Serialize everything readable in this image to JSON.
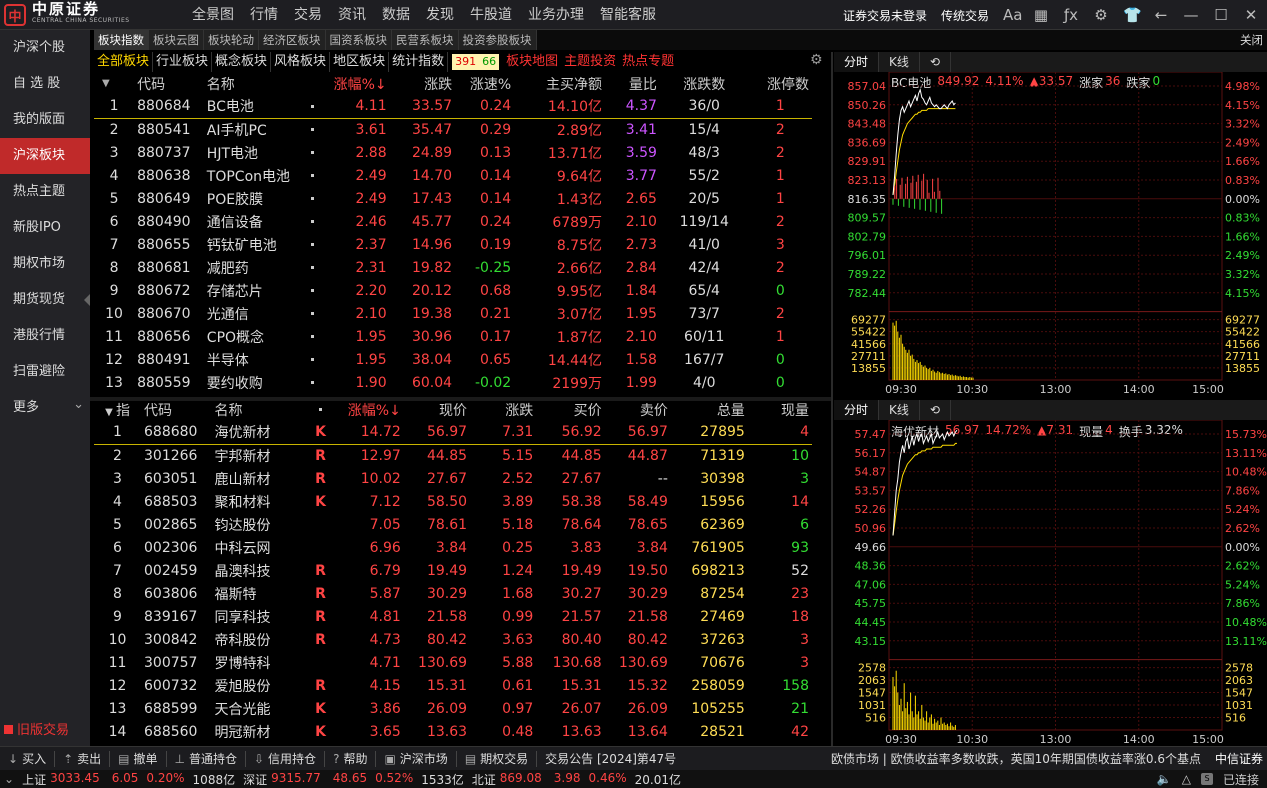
{
  "app": {
    "logo_cn": "中原证券",
    "logo_en": "CENTRAL CHINA SECURITIES"
  },
  "topnav": [
    "全景图",
    "行情",
    "交易",
    "资讯",
    "数据",
    "发现",
    "牛股道",
    "业务办理",
    "智能客服"
  ],
  "topright": {
    "login": "证券交易未登录",
    "mode": "传统交易",
    "font_icon": "font-size-icon",
    "icons": [
      "grid-icon",
      "fx-icon",
      "gear-icon",
      "shirt-icon",
      "back-icon",
      "minimize-icon",
      "maximize-icon",
      "close-icon"
    ]
  },
  "sidebar": {
    "items": [
      "沪深个股",
      "自 选 股",
      "我的版面",
      "沪深板块",
      "热点主题",
      "新股IPO",
      "期权市场",
      "期货现货",
      "港股行情",
      "扫雷避险",
      "更多"
    ],
    "active": 3,
    "old": "旧版交易"
  },
  "tabs": [
    "板块指数",
    "板块云图",
    "板块轮动",
    "经济区板块",
    "国资系板块",
    "民营系板块",
    "投资参股板块"
  ],
  "tabs_close": "关闭",
  "filters": [
    "全部板块",
    "行业板块",
    "概念板块",
    "风格板块",
    "地区板块",
    "统计指数"
  ],
  "filter_counts": [
    "391",
    "66"
  ],
  "filter_links": [
    "板块地图",
    "主题投资",
    "热点专题"
  ],
  "sector_header": [
    "代码",
    "名称",
    "",
    "涨幅%↓",
    "涨跌",
    "涨速%",
    "主买净额",
    "量比",
    "涨跌数",
    "涨停数"
  ],
  "sectors": [
    [
      "1",
      "880684",
      "BC电池",
      "4.11",
      "33.57",
      "0.24",
      "14.10亿",
      "4.37",
      "36/0",
      "1"
    ],
    [
      "2",
      "880541",
      "AI手机PC",
      "3.61",
      "35.47",
      "0.29",
      "2.89亿",
      "3.41",
      "15/4",
      "2"
    ],
    [
      "3",
      "880737",
      "HJT电池",
      "2.88",
      "24.89",
      "0.13",
      "13.71亿",
      "3.59",
      "48/3",
      "2"
    ],
    [
      "4",
      "880638",
      "TOPCon电池",
      "2.49",
      "14.70",
      "0.14",
      "9.64亿",
      "3.77",
      "55/2",
      "1"
    ],
    [
      "5",
      "880649",
      "POE胶膜",
      "2.49",
      "17.43",
      "0.14",
      "1.43亿",
      "2.65",
      "20/5",
      "1"
    ],
    [
      "6",
      "880490",
      "通信设备",
      "2.46",
      "45.77",
      "0.24",
      "6789万",
      "2.10",
      "119/14",
      "2"
    ],
    [
      "7",
      "880655",
      "钙钛矿电池",
      "2.37",
      "14.96",
      "0.19",
      "8.75亿",
      "2.73",
      "41/0",
      "3"
    ],
    [
      "8",
      "880681",
      "减肥药",
      "2.31",
      "19.82",
      "-0.25",
      "2.66亿",
      "2.84",
      "42/4",
      "2"
    ],
    [
      "9",
      "880672",
      "存储芯片",
      "2.20",
      "20.12",
      "0.68",
      "9.95亿",
      "1.84",
      "65/4",
      "0"
    ],
    [
      "10",
      "880670",
      "光通信",
      "2.10",
      "19.38",
      "0.21",
      "3.07亿",
      "1.95",
      "73/7",
      "2"
    ],
    [
      "11",
      "880656",
      "CPO概念",
      "1.95",
      "30.96",
      "0.17",
      "1.87亿",
      "2.10",
      "60/11",
      "1"
    ],
    [
      "12",
      "880491",
      "半导体",
      "1.95",
      "38.04",
      "0.65",
      "14.44亿",
      "1.58",
      "167/7",
      "0"
    ],
    [
      "13",
      "880559",
      "要约收购",
      "1.90",
      "60.04",
      "-0.02",
      "2199万",
      "1.99",
      "4/0",
      "0"
    ]
  ],
  "stock_header": [
    "指",
    "代码",
    "名称",
    "",
    "涨幅%↓",
    "现价",
    "涨跌",
    "买价",
    "卖价",
    "总量",
    "现量"
  ],
  "stocks": [
    [
      "1",
      "688680",
      "海优新材",
      "K",
      "14.72",
      "56.97",
      "7.31",
      "56.92",
      "56.97",
      "27895",
      "4"
    ],
    [
      "2",
      "301266",
      "宇邦新材",
      "R",
      "12.97",
      "44.85",
      "5.15",
      "44.85",
      "44.87",
      "71319",
      "10"
    ],
    [
      "3",
      "603051",
      "鹿山新材",
      "R",
      "10.02",
      "27.67",
      "2.52",
      "27.67",
      "--",
      "30398",
      "3"
    ],
    [
      "4",
      "688503",
      "聚和材料",
      "K",
      "7.12",
      "58.50",
      "3.89",
      "58.38",
      "58.49",
      "15956",
      "14"
    ],
    [
      "5",
      "002865",
      "钧达股份",
      "",
      "7.05",
      "78.61",
      "5.18",
      "78.64",
      "78.65",
      "62369",
      "6"
    ],
    [
      "6",
      "002306",
      "中科云网",
      "",
      "6.96",
      "3.84",
      "0.25",
      "3.83",
      "3.84",
      "761905",
      "93"
    ],
    [
      "7",
      "002459",
      "晶澳科技",
      "R",
      "6.79",
      "19.49",
      "1.24",
      "19.49",
      "19.50",
      "698213",
      "52"
    ],
    [
      "8",
      "603806",
      "福斯特",
      "R",
      "5.87",
      "30.29",
      "1.68",
      "30.27",
      "30.29",
      "87254",
      "23"
    ],
    [
      "9",
      "839167",
      "同享科技",
      "R",
      "4.81",
      "21.58",
      "0.99",
      "21.57",
      "21.58",
      "27469",
      "18"
    ],
    [
      "10",
      "300842",
      "帝科股份",
      "R",
      "4.73",
      "80.42",
      "3.63",
      "80.40",
      "80.42",
      "37263",
      "3"
    ],
    [
      "11",
      "300757",
      "罗博特科",
      "",
      "4.71",
      "130.69",
      "5.88",
      "130.68",
      "130.69",
      "70676",
      "3"
    ],
    [
      "12",
      "600732",
      "爱旭股份",
      "R",
      "4.15",
      "15.31",
      "0.61",
      "15.31",
      "15.32",
      "258059",
      "158"
    ],
    [
      "13",
      "688599",
      "天合光能",
      "K",
      "3.86",
      "26.09",
      "0.97",
      "26.07",
      "26.09",
      "105255",
      "21"
    ],
    [
      "14",
      "688560",
      "明冠新材",
      "K",
      "3.65",
      "13.63",
      "0.48",
      "13.63",
      "13.64",
      "28521",
      "42"
    ]
  ],
  "stock_colors": {
    "vol": [
      "r",
      "g",
      "g",
      "r",
      "g",
      "g",
      "w",
      "r",
      "r",
      "r",
      "r",
      "g",
      "g",
      "r"
    ]
  },
  "chart1": {
    "tabs": [
      "分时",
      "K线"
    ],
    "name": "BC电池",
    "price": "849.92",
    "pct": "4.11%",
    "chg": "▲33.57",
    "up_label": "涨家",
    "up": "36",
    "down_label": "跌家",
    "down": "0",
    "yleft": [
      "857.04",
      "850.26",
      "843.48",
      "836.69",
      "829.91",
      "823.13",
      "816.35",
      "809.57",
      "802.79",
      "796.01",
      "789.22",
      "782.44"
    ],
    "yright": [
      "4.98%",
      "4.15%",
      "3.32%",
      "2.49%",
      "1.66%",
      "0.83%",
      "0.00%",
      "0.83%",
      "1.66%",
      "2.49%",
      "3.32%",
      "4.15%"
    ],
    "vleft": [
      "69277",
      "55422",
      "41566",
      "27711",
      "13855"
    ],
    "vright": [
      "69277",
      "55422",
      "41566",
      "27711",
      "13855"
    ],
    "xlabels": [
      "09:30",
      "10:30",
      "13:00",
      "14:00",
      "15:00"
    ]
  },
  "chart2": {
    "tabs": [
      "分时",
      "K线"
    ],
    "name": "海优新材",
    "price": "56.97",
    "pct": "14.72%",
    "chg": "▲7.31",
    "vol_label": "现量",
    "vol": "4",
    "turn_label": "换手",
    "turn": "3.32%",
    "yleft": [
      "57.47",
      "56.17",
      "54.87",
      "53.57",
      "52.26",
      "50.96",
      "49.66",
      "48.36",
      "47.06",
      "45.75",
      "44.45",
      "43.15"
    ],
    "yright": [
      "15.73%",
      "13.11%",
      "10.48%",
      "7.86%",
      "5.24%",
      "2.62%",
      "0.00%",
      "2.62%",
      "5.24%",
      "7.86%",
      "10.48%",
      "13.11%"
    ],
    "vleft": [
      "2578",
      "2063",
      "1547",
      "1031",
      "516"
    ],
    "vright": [
      "2578",
      "2063",
      "1547",
      "1031",
      "516"
    ],
    "xlabels": [
      "09:30",
      "10:30",
      "13:00",
      "14:00",
      "15:00"
    ]
  },
  "bottom": {
    "items": [
      "买入",
      "卖出",
      "撤单",
      "普通持仓",
      "信用持仓",
      "帮助",
      "沪深市场",
      "期权交易"
    ],
    "news1": "交易公告 [2024]第47号",
    "news2": "欧债市场 | 欧债收益率多数收跌，英国10年期国债收益率涨0.6个基点",
    "brand": "中信证券"
  },
  "status": {
    "sh_label": "上证",
    "sh": "3033.45",
    "sh_chg": "6.05",
    "sh_pct": "0.20%",
    "sh_amt": "1088亿",
    "sz_label": "深证",
    "sz": "9315.77",
    "sz_chg": "48.65",
    "sz_pct": "0.52%",
    "sz_amt": "1533亿",
    "bz_label": "北证",
    "bz": "869.08",
    "bz_chg": "3.98",
    "bz_pct": "0.46%",
    "bz_amt": "20.01亿",
    "conn": "已连接"
  }
}
